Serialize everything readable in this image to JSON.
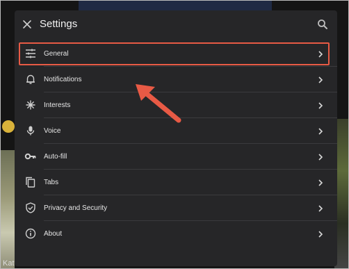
{
  "background": {
    "partial_text": "Kat"
  },
  "dialog": {
    "title": "Settings",
    "items": [
      {
        "label": "General",
        "icon": "sliders-icon"
      },
      {
        "label": "Notifications",
        "icon": "bell-icon"
      },
      {
        "label": "Interests",
        "icon": "asterisk-icon"
      },
      {
        "label": "Voice",
        "icon": "microphone-icon"
      },
      {
        "label": "Auto-fill",
        "icon": "key-icon"
      },
      {
        "label": "Tabs",
        "icon": "tabs-icon"
      },
      {
        "label": "Privacy and Security",
        "icon": "shield-icon"
      },
      {
        "label": "About",
        "icon": "info-icon"
      }
    ]
  },
  "colors": {
    "highlight": "#e85a45",
    "dialog_bg": "#262628"
  }
}
